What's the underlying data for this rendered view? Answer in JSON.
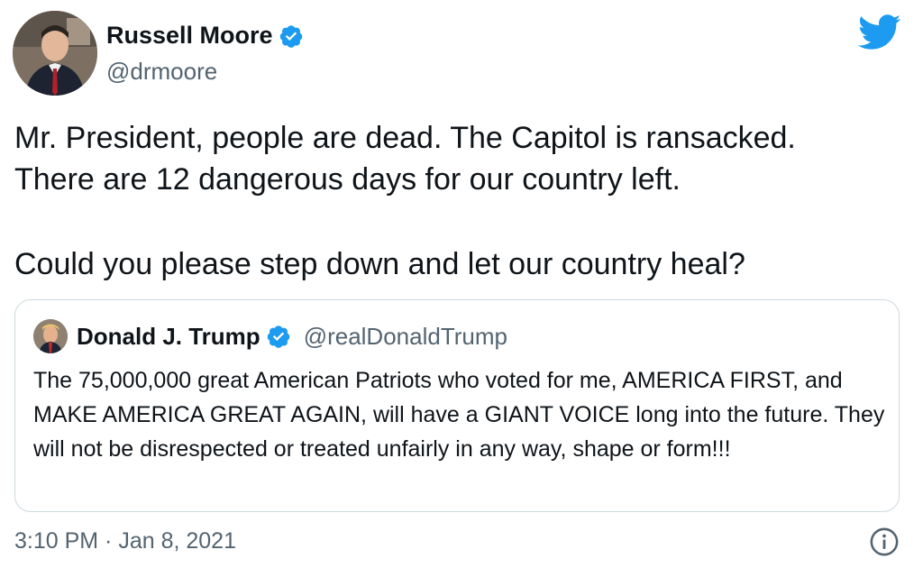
{
  "author": {
    "name": "Russell Moore",
    "handle": "@drmoore"
  },
  "tweet": {
    "line1": "Mr. President, people are dead. The Capitol is ransacked.",
    "line2": "There are 12 dangerous days for our country left.",
    "line3": "Could you please step down and let our country heal?"
  },
  "quoted": {
    "name": "Donald J. Trump",
    "handle": "@realDonaldTrump",
    "text": "The 75,000,000 great American Patriots who voted for me, AMERICA FIRST, and MAKE AMERICA GREAT AGAIN, will have a GIANT VOICE long into the future. They will not be disrespected or treated unfairly in any way, shape or form!!!"
  },
  "meta": {
    "timestamp": "3:10 PM · Jan 8, 2021"
  },
  "icons": {
    "verified": "verified-badge-icon",
    "platform": "twitter-bird-icon",
    "info": "info-icon"
  },
  "colors": {
    "accent": "#1d9bf0",
    "text": "#0f1419",
    "secondary": "#536471",
    "border": "#cfd9de"
  }
}
